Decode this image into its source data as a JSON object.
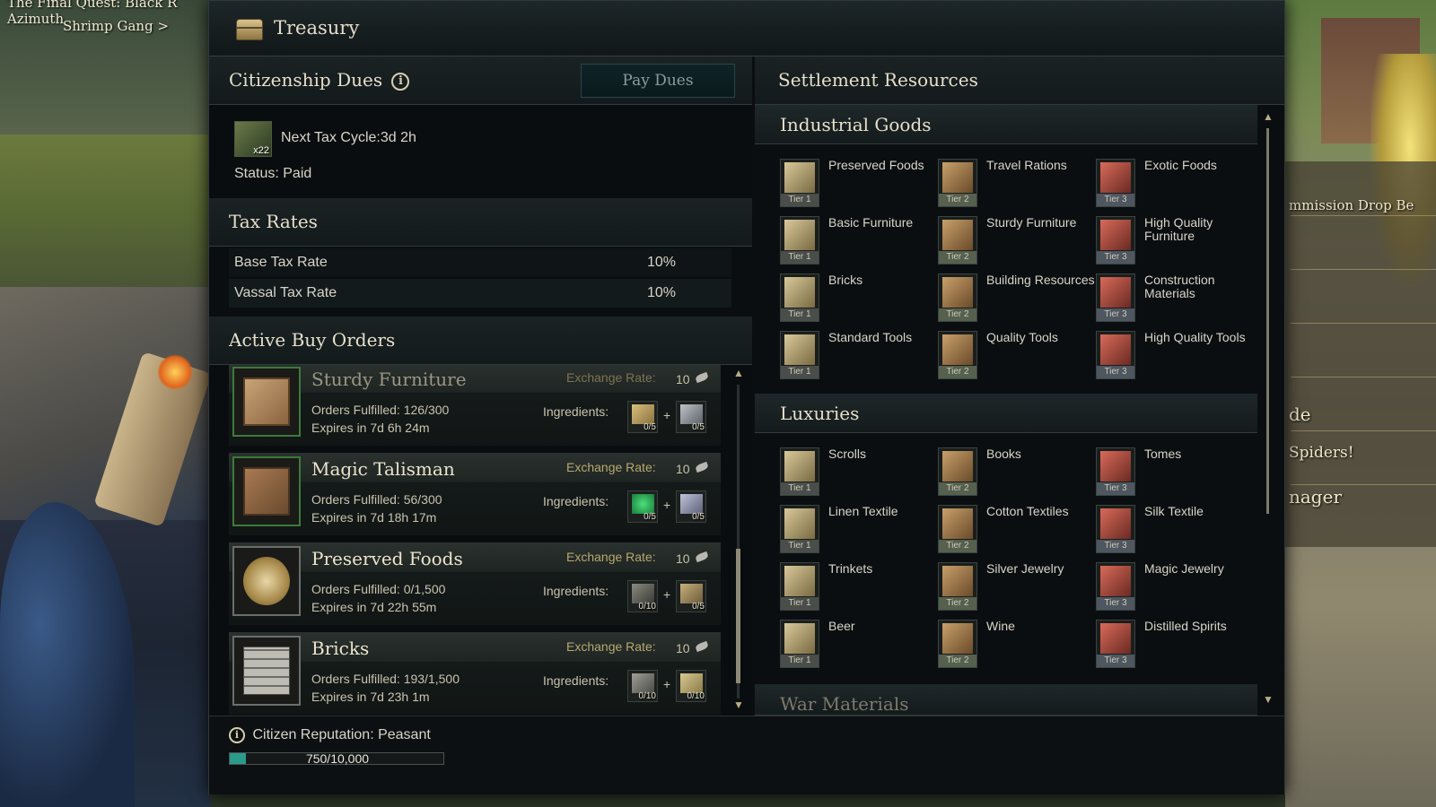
{
  "background": {
    "hud_lines": [
      "The Final Quest: Black R",
      "Azimuth",
      "Shrimp Gang >"
    ],
    "side_items": [
      "mmission Drop Be",
      "de",
      "Spiders!",
      "nager"
    ]
  },
  "window": {
    "title": "Treasury"
  },
  "dues": {
    "header": "Citizenship Dues",
    "info_icon": "i",
    "pay_button": "Pay Dues",
    "ticket_qty": "x22",
    "next_cycle": "Next Tax Cycle:3d 2h",
    "status": "Status: Paid"
  },
  "tax": {
    "header": "Tax Rates",
    "rows": [
      {
        "label": "Base Tax Rate",
        "value": "10%"
      },
      {
        "label": "Vassal Tax Rate",
        "value": "10%"
      }
    ]
  },
  "orders": {
    "header": "Active Buy Orders",
    "rate_label": "Exchange Rate:",
    "ingredients_label": "Ingredients:",
    "plus": "+",
    "items": [
      {
        "name": "Sturdy Furniture",
        "rate": "10",
        "fulfilled": "Orders Fulfilled: 126/300",
        "expires": "Expires in 7d 6h 24m",
        "ing1": "0/5",
        "ing2": "0/5"
      },
      {
        "name": "Magic Talisman",
        "rate": "10",
        "fulfilled": "Orders Fulfilled: 56/300",
        "expires": "Expires in 7d 18h 17m",
        "ing1": "0/5",
        "ing2": "0/5"
      },
      {
        "name": "Preserved Foods",
        "rate": "10",
        "fulfilled": "Orders Fulfilled: 0/1,500",
        "expires": "Expires in 7d 22h 55m",
        "ing1": "0/10",
        "ing2": "0/5"
      },
      {
        "name": "Bricks",
        "rate": "10",
        "fulfilled": "Orders Fulfilled: 193/1,500",
        "expires": "Expires in 7d 23h 1m",
        "ing1": "0/10",
        "ing2": "0/10"
      }
    ]
  },
  "reputation": {
    "label": "Citizen Reputation: Peasant",
    "progress_text": "750/10,000",
    "progress_fraction": 0.075
  },
  "resources": {
    "header": "Settlement Resources",
    "categories": [
      {
        "name": "Industrial Goods",
        "items": [
          {
            "label": "Preserved Foods",
            "tier": "Tier 1"
          },
          {
            "label": "Travel Rations",
            "tier": "Tier 2"
          },
          {
            "label": "Exotic Foods",
            "tier": "Tier 3"
          },
          {
            "label": "Basic Furniture",
            "tier": "Tier 1"
          },
          {
            "label": "Sturdy Furniture",
            "tier": "Tier 2"
          },
          {
            "label": "High Quality Furniture",
            "tier": "Tier 3"
          },
          {
            "label": "Bricks",
            "tier": "Tier 1"
          },
          {
            "label": "Building Resources",
            "tier": "Tier 2"
          },
          {
            "label": "Construction Materials",
            "tier": "Tier 3"
          },
          {
            "label": "Standard Tools",
            "tier": "Tier 1"
          },
          {
            "label": "Quality Tools",
            "tier": "Tier 2"
          },
          {
            "label": "High Quality Tools",
            "tier": "Tier 3"
          }
        ]
      },
      {
        "name": "Luxuries",
        "items": [
          {
            "label": "Scrolls",
            "tier": "Tier 1"
          },
          {
            "label": "Books",
            "tier": "Tier 2"
          },
          {
            "label": "Tomes",
            "tier": "Tier 3"
          },
          {
            "label": "Linen Textile",
            "tier": "Tier 1"
          },
          {
            "label": "Cotton Textiles",
            "tier": "Tier 2"
          },
          {
            "label": "Silk Textile",
            "tier": "Tier 3"
          },
          {
            "label": "Trinkets",
            "tier": "Tier 1"
          },
          {
            "label": "Silver Jewelry",
            "tier": "Tier 2"
          },
          {
            "label": "Magic Jewelry",
            "tier": "Tier 3"
          },
          {
            "label": "Beer",
            "tier": "Tier 1"
          },
          {
            "label": "Wine",
            "tier": "Tier 2"
          },
          {
            "label": "Distilled Spirits",
            "tier": "Tier 3"
          }
        ]
      },
      {
        "name": "War Materials",
        "items": []
      }
    ]
  },
  "colors": {
    "accent_gold": "#b7a86e",
    "order_border_green": "#3d7a3a",
    "reputation_fill": "#2a9a8a"
  }
}
